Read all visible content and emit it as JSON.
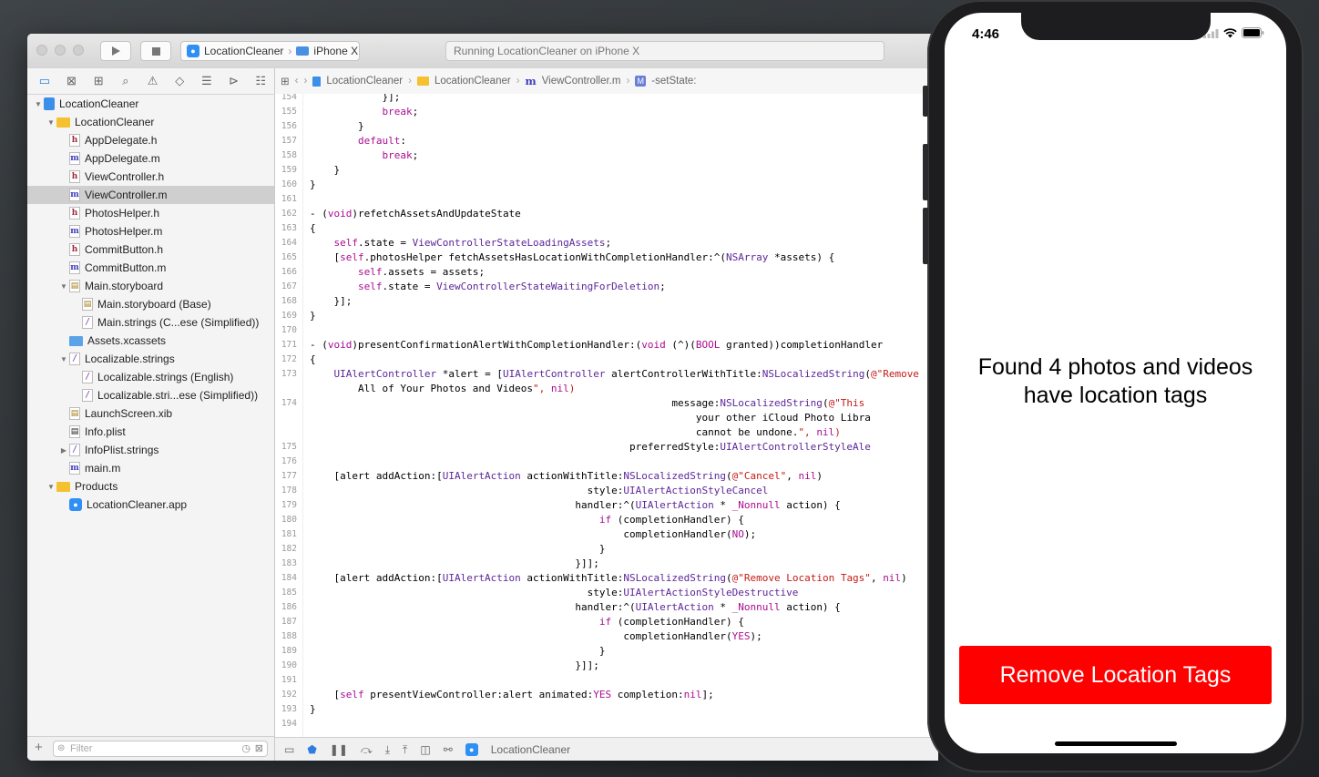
{
  "toolbar": {
    "scheme_target": "LocationCleaner",
    "scheme_device": "iPhone X",
    "activity": "Running LocationCleaner on iPhone X"
  },
  "jumpbar": {
    "crumbs": [
      "LocationCleaner",
      "LocationCleaner",
      "ViewController.m",
      "-setState:"
    ]
  },
  "navigator": {
    "items": [
      {
        "label": "LocationCleaner",
        "kind": "project",
        "level": 0,
        "disclosure": "open"
      },
      {
        "label": "LocationCleaner",
        "kind": "folder",
        "level": 1,
        "disclosure": "open"
      },
      {
        "label": "AppDelegate.h",
        "kind": "h",
        "level": 2
      },
      {
        "label": "AppDelegate.m",
        "kind": "m",
        "level": 2
      },
      {
        "label": "ViewController.h",
        "kind": "h",
        "level": 2
      },
      {
        "label": "ViewController.m",
        "kind": "m",
        "level": 2,
        "selected": true
      },
      {
        "label": "PhotosHelper.h",
        "kind": "h",
        "level": 2
      },
      {
        "label": "PhotosHelper.m",
        "kind": "m",
        "level": 2
      },
      {
        "label": "CommitButton.h",
        "kind": "h",
        "level": 2
      },
      {
        "label": "CommitButton.m",
        "kind": "m",
        "level": 2
      },
      {
        "label": "Main.storyboard",
        "kind": "s",
        "level": 2,
        "disclosure": "open"
      },
      {
        "label": "Main.storyboard (Base)",
        "kind": "s",
        "level": 3
      },
      {
        "label": "Main.strings (C...ese (Simplified))",
        "kind": "str",
        "level": 3
      },
      {
        "label": "Assets.xcassets",
        "kind": "folder-blue",
        "level": 2
      },
      {
        "label": "Localizable.strings",
        "kind": "str",
        "level": 2,
        "disclosure": "open"
      },
      {
        "label": "Localizable.strings (English)",
        "kind": "str",
        "level": 3
      },
      {
        "label": "Localizable.stri...ese (Simplified))",
        "kind": "str",
        "level": 3
      },
      {
        "label": "LaunchScreen.xib",
        "kind": "s",
        "level": 2
      },
      {
        "label": "Info.plist",
        "kind": "plist",
        "level": 2
      },
      {
        "label": "InfoPlist.strings",
        "kind": "str",
        "level": 2,
        "disclosure": "closed"
      },
      {
        "label": "main.m",
        "kind": "m",
        "level": 2
      },
      {
        "label": "Products",
        "kind": "folder",
        "level": 1,
        "disclosure": "open"
      },
      {
        "label": "LocationCleaner.app",
        "kind": "app",
        "level": 2
      }
    ],
    "filter_placeholder": "Filter"
  },
  "editor": {
    "lines": [
      {
        "n": "154",
        "t": "            }];"
      },
      {
        "n": "155",
        "t": "            break;"
      },
      {
        "n": "156",
        "t": "        }"
      },
      {
        "n": "157",
        "t": "        default:"
      },
      {
        "n": "158",
        "t": "            break;"
      },
      {
        "n": "159",
        "t": "    }"
      },
      {
        "n": "160",
        "t": "}"
      },
      {
        "n": "161",
        "t": ""
      },
      {
        "n": "162",
        "t": "- (void)refetchAssetsAndUpdateState"
      },
      {
        "n": "163",
        "t": "{"
      },
      {
        "n": "164",
        "t": "    self.state = ViewControllerStateLoadingAssets;"
      },
      {
        "n": "165",
        "t": "    [self.photosHelper fetchAssetsHasLocationWithCompletionHandler:^(NSArray *assets) {"
      },
      {
        "n": "166",
        "t": "        self.assets = assets;"
      },
      {
        "n": "167",
        "t": "        self.state = ViewControllerStateWaitingForDeletion;"
      },
      {
        "n": "168",
        "t": "    }];"
      },
      {
        "n": "169",
        "t": "}"
      },
      {
        "n": "170",
        "t": ""
      },
      {
        "n": "171",
        "t": "- (void)presentConfirmationAlertWithCompletionHandler:(void (^)(BOOL granted))completionHandler"
      },
      {
        "n": "172",
        "t": "{"
      },
      {
        "n": "173",
        "t": "    UIAlertController *alert = [UIAlertController alertControllerWithTitle:NSLocalizedString(@\"Remove"
      },
      {
        "n": "",
        "t": "        All of Your Photos and Videos\", nil)"
      },
      {
        "n": "174",
        "t": "                                                            message:NSLocalizedString(@\"This"
      },
      {
        "n": "",
        "t": "                                                                your other iCloud Photo Libra"
      },
      {
        "n": "",
        "t": "                                                                cannot be undone.\", nil)"
      },
      {
        "n": "175",
        "t": "                                                     preferredStyle:UIAlertControllerStyleAle"
      },
      {
        "n": "176",
        "t": ""
      },
      {
        "n": "177",
        "t": "    [alert addAction:[UIAlertAction actionWithTitle:NSLocalizedString(@\"Cancel\", nil)"
      },
      {
        "n": "178",
        "t": "                                              style:UIAlertActionStyleCancel"
      },
      {
        "n": "179",
        "t": "                                            handler:^(UIAlertAction * _Nonnull action) {"
      },
      {
        "n": "180",
        "t": "                                                if (completionHandler) {"
      },
      {
        "n": "181",
        "t": "                                                    completionHandler(NO);"
      },
      {
        "n": "182",
        "t": "                                                }"
      },
      {
        "n": "183",
        "t": "                                            }]];"
      },
      {
        "n": "184",
        "t": "    [alert addAction:[UIAlertAction actionWithTitle:NSLocalizedString(@\"Remove Location Tags\", nil)"
      },
      {
        "n": "185",
        "t": "                                              style:UIAlertActionStyleDestructive"
      },
      {
        "n": "186",
        "t": "                                            handler:^(UIAlertAction * _Nonnull action) {"
      },
      {
        "n": "187",
        "t": "                                                if (completionHandler) {"
      },
      {
        "n": "188",
        "t": "                                                    completionHandler(YES);"
      },
      {
        "n": "189",
        "t": "                                                }"
      },
      {
        "n": "190",
        "t": "                                            }]];"
      },
      {
        "n": "191",
        "t": ""
      },
      {
        "n": "192",
        "t": "    [self presentViewController:alert animated:YES completion:nil];"
      },
      {
        "n": "193",
        "t": "}"
      },
      {
        "n": "194",
        "t": ""
      }
    ]
  },
  "debugbar": {
    "target": "LocationCleaner"
  },
  "phone": {
    "time": "4:46",
    "message_line1": "Found 4 photos and videos",
    "message_line2": "have location tags",
    "button_label": "Remove Location Tags",
    "button_color": "#fe0000"
  }
}
